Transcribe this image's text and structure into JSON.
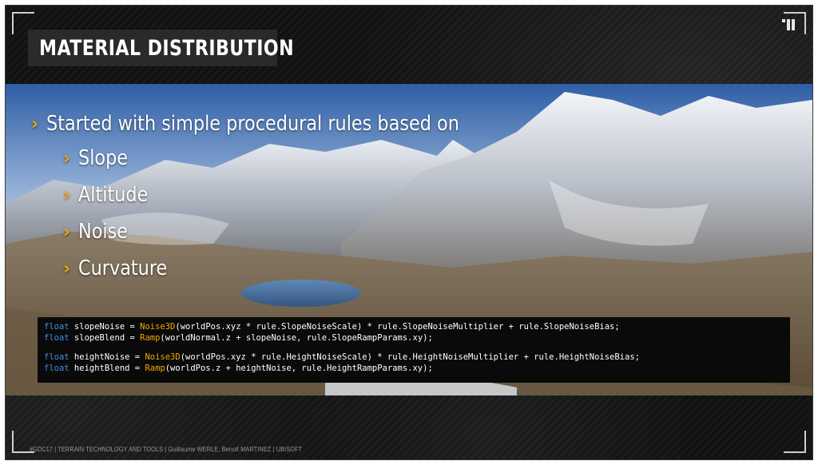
{
  "slide": {
    "title": "MATERIAL DISTRIBUTION",
    "bullets": {
      "main": "Started with simple procedural rules based on",
      "sub": [
        "Slope",
        "Altitude",
        "Noise",
        "Curvature"
      ]
    },
    "code": {
      "line1": {
        "kw": "float",
        "a": " slopeNoise = ",
        "fn": "Noise3D",
        "b": "(worldPos.xyz * rule.SlopeNoiseScale) * rule.SlopeNoiseMultiplier + rule.SlopeNoiseBias;"
      },
      "line2": {
        "kw": "float",
        "a": " slopeBlend = ",
        "fn": "Ramp",
        "b": "(worldNormal.z + slopeNoise, rule.SlopeRampParams.xy);"
      },
      "line3": {
        "kw": "float",
        "a": " heightNoise = ",
        "fn": "Noise3D",
        "b": "(worldPos.xyz * rule.HeightNoiseScale) * rule.HeightNoiseMultiplier + rule.HeightNoiseBias;"
      },
      "line4": {
        "kw": "float",
        "a": " heightBlend = ",
        "fn": "Ramp",
        "b": "(worldPos.z + heightNoise, rule.HeightRampParams.xy);"
      }
    },
    "footer": "#GDC17 | TERRAIN TECHNOLOGY AND TOOLS | Guillaume WERLE, Benoit MARTINEZ | UBISOFT"
  },
  "colors": {
    "accent": "#f2a900",
    "keyword": "#3f8fe8",
    "background": "#111214"
  },
  "icons": {
    "bullet": "chevron-right-icon",
    "logo": "ubisoft-logo-icon"
  }
}
